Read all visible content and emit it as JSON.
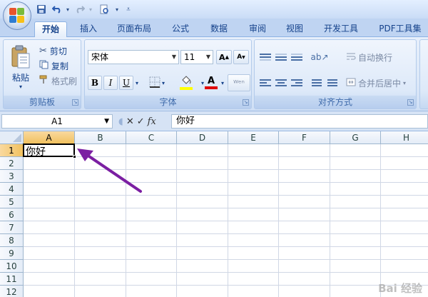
{
  "quick_access": {
    "icons": [
      "save-icon",
      "undo-icon",
      "redo-icon",
      "print-preview-icon",
      "customize-icon"
    ]
  },
  "tabs": [
    "开始",
    "插入",
    "页面布局",
    "公式",
    "数据",
    "审阅",
    "视图",
    "开发工具",
    "PDF工具集"
  ],
  "active_tab": "开始",
  "clipboard": {
    "paste_label": "粘贴",
    "cut_label": "剪切",
    "copy_label": "复制",
    "format_painter_label": "格式刷",
    "group_label": "剪贴板"
  },
  "font": {
    "font_name": "宋体",
    "font_size": "11",
    "bold": "B",
    "italic": "I",
    "underline": "U",
    "group_label": "字体",
    "font_color": "#e00000",
    "fill_color": "#ffff00"
  },
  "alignment": {
    "wrap_text_label": "自动换行",
    "merge_center_label": "合并后居中",
    "group_label": "对齐方式"
  },
  "formula_bar": {
    "name_box": "A1",
    "cancel_symbol": "✕",
    "enter_symbol": "✓",
    "fx_symbol": "fx",
    "content": "你好"
  },
  "sheet": {
    "columns": [
      "A",
      "B",
      "C",
      "D",
      "E",
      "F",
      "G",
      "H"
    ],
    "rows": [
      "1",
      "2",
      "3",
      "4",
      "5",
      "6",
      "7",
      "8",
      "9",
      "10",
      "11",
      "12"
    ],
    "selected_cell": "A1",
    "cells": {
      "A1": "你好"
    }
  },
  "annotation": {
    "arrow_color": "#7b1fa2"
  },
  "watermark": "Bai 经验"
}
